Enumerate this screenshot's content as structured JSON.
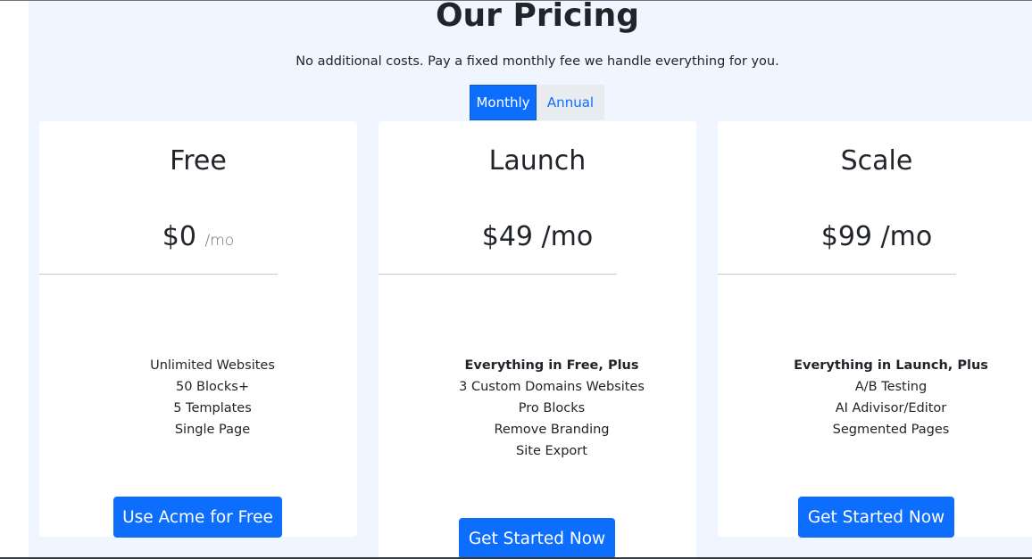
{
  "header": {
    "title": "Our Pricing",
    "subtitle": "No additional costs. Pay a fixed monthly fee we handle everything for you."
  },
  "billing_toggle": {
    "monthly_label": "Monthly",
    "annual_label": "Annual",
    "selected": "Monthly"
  },
  "plans": [
    {
      "name": "Free",
      "price": "$0",
      "unit": "/mo",
      "features": [
        "Unlimited Websites",
        "50 Blocks+",
        "5 Templates",
        "Single Page"
      ],
      "cta": "Use Acme for Free"
    },
    {
      "name": "Launch",
      "price": "$49 /mo",
      "features_heading": "Everything in Free, Plus",
      "features": [
        "3 Custom Domains Websites",
        "Pro Blocks",
        "Remove Branding",
        "Site Export"
      ],
      "cta": "Get Started Now"
    },
    {
      "name": "Scale",
      "price": "$99 /mo",
      "features_heading": "Everything in Launch, Plus",
      "features": [
        "A/B Testing",
        "AI Adivisor/Editor",
        "Segmented Pages"
      ],
      "cta": "Get Started Now"
    }
  ],
  "colors": {
    "accent": "#0d6efd",
    "section_background": "#f0f6ff",
    "card_background": "#ffffff",
    "text": "#212529",
    "muted": "#6c757d"
  }
}
